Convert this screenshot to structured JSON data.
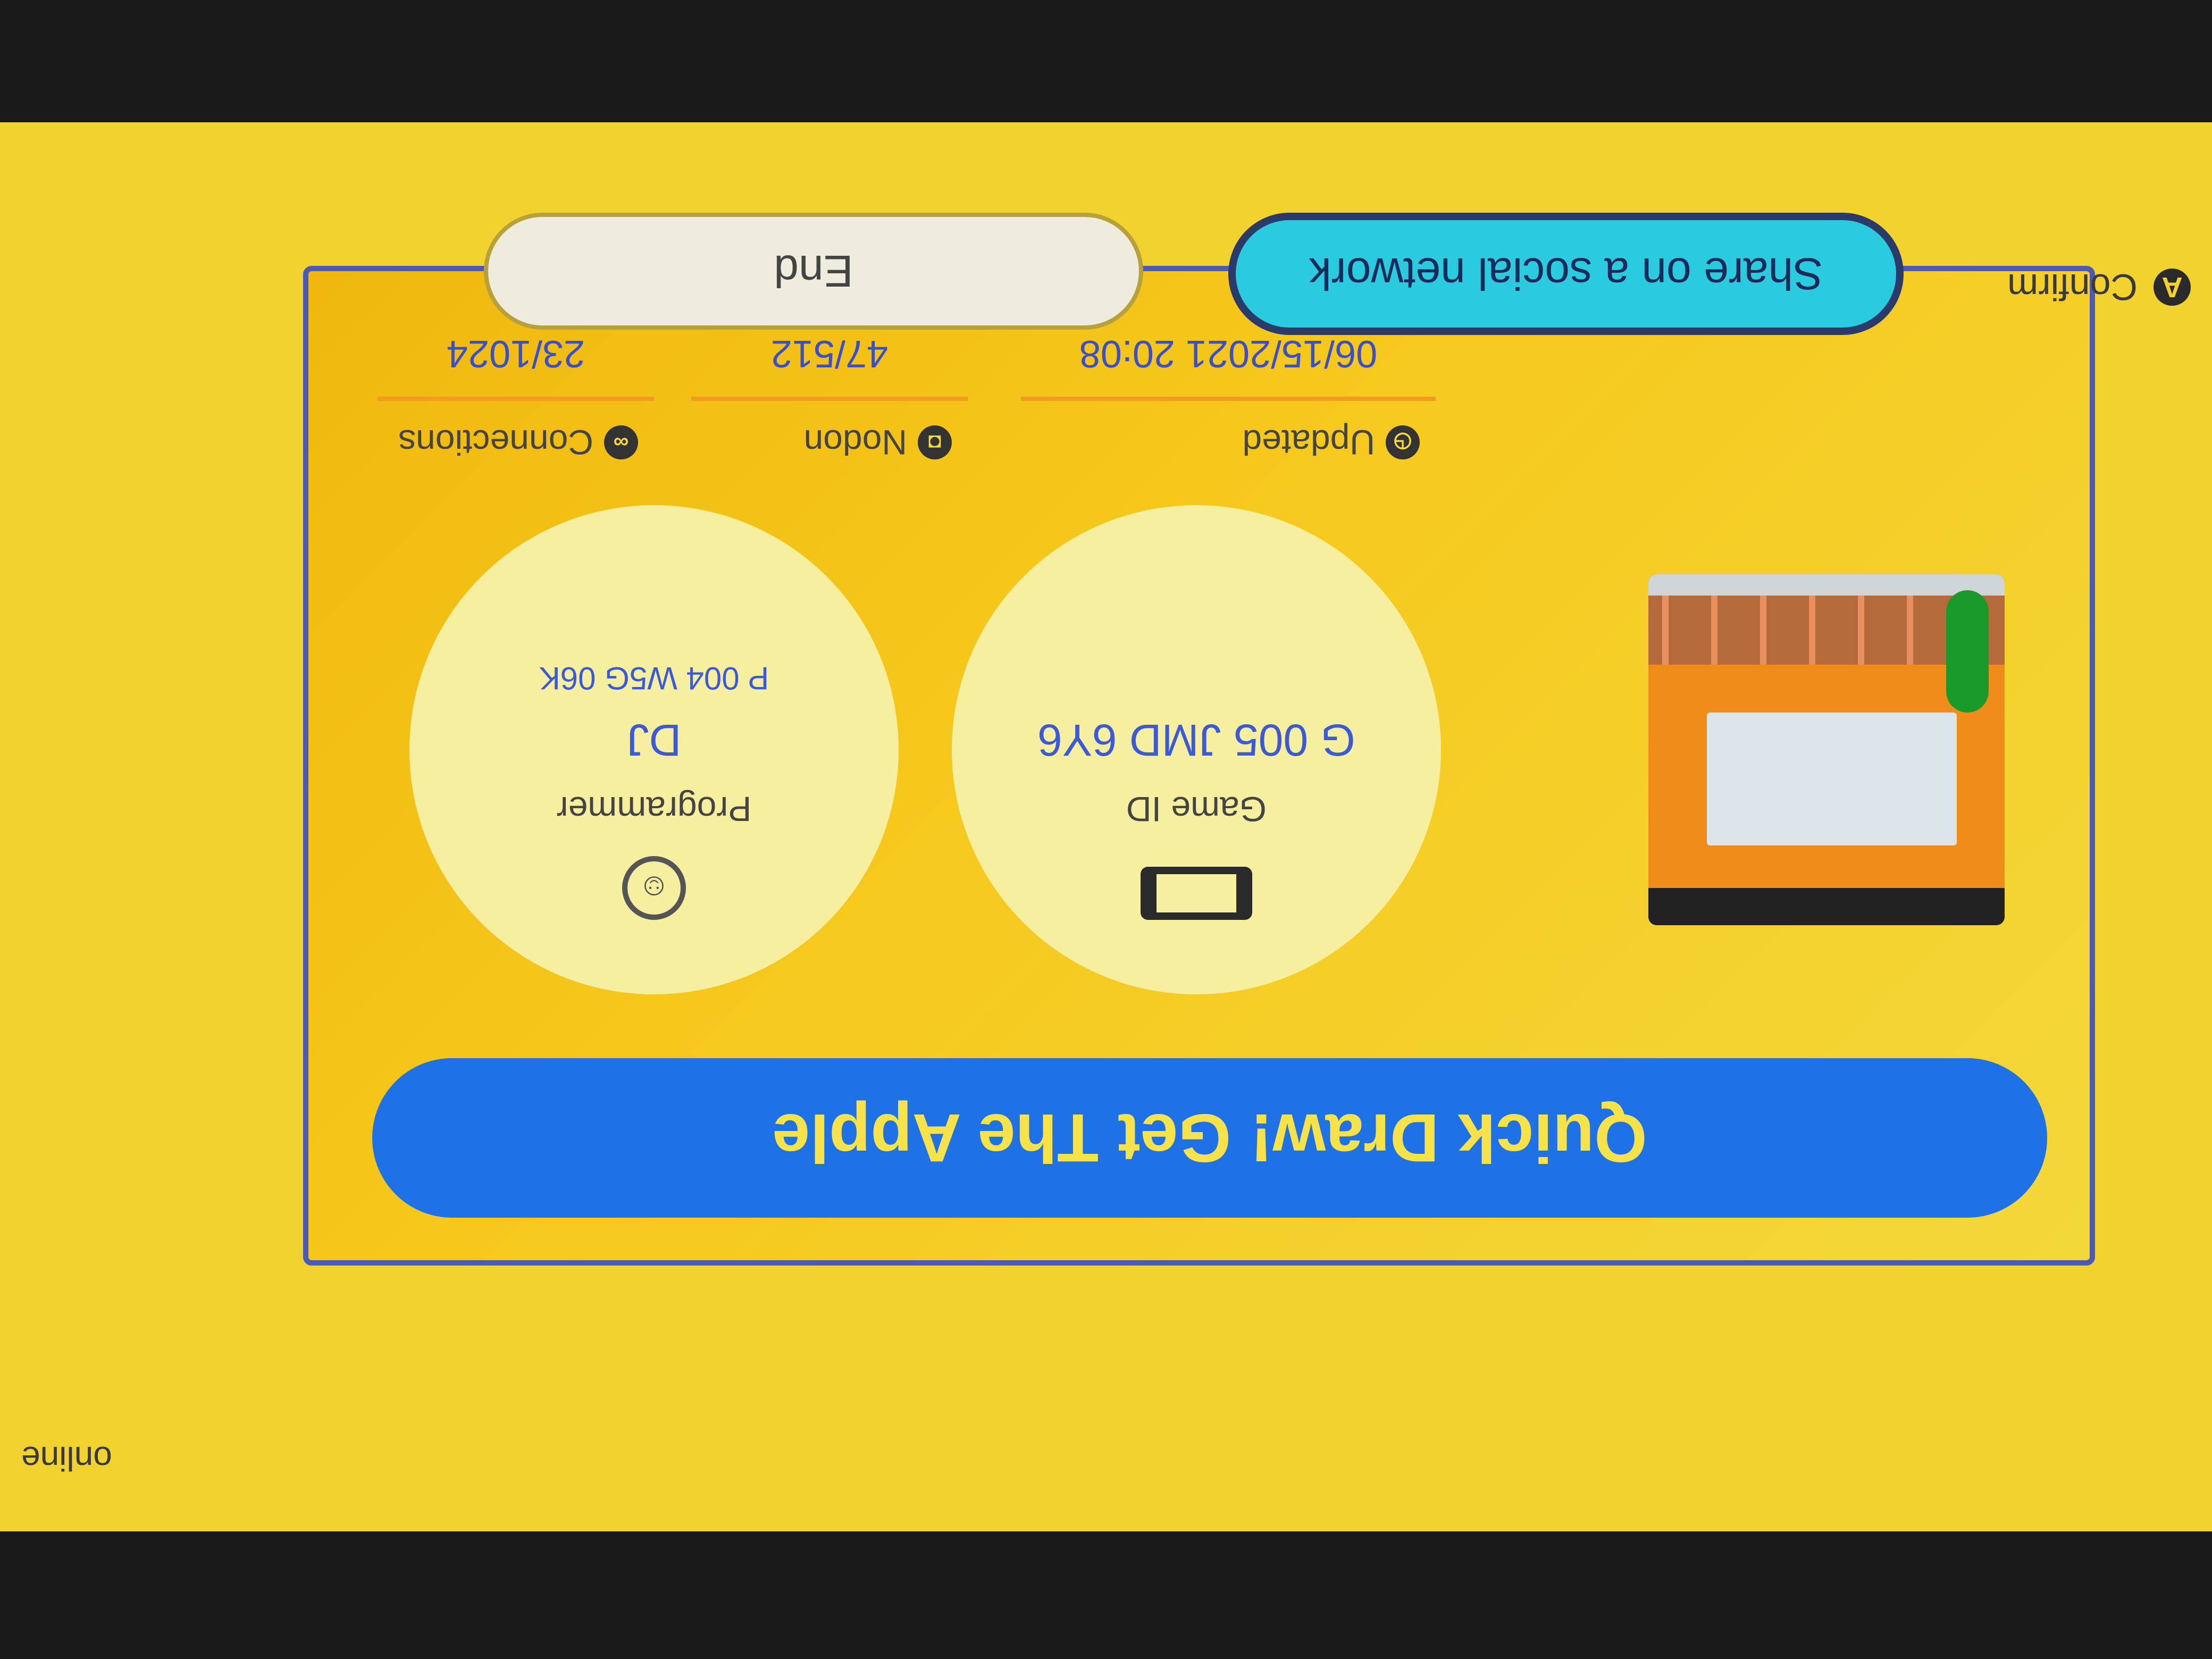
{
  "screen": {
    "status_left_label": "Confirm",
    "status_left_button": "A",
    "status_right_label": "online"
  },
  "actions": {
    "share_label": "Share on a social network",
    "end_label": "End"
  },
  "game": {
    "title": "Quick Draw! Get The Apple",
    "game_id_label": "Game ID",
    "game_id_value": "G 005 JMD 6Y6",
    "programmer_label": "Programmer",
    "programmer_name": "DJ",
    "programmer_id": "P 004 W5G 06K",
    "device_icon": "switch-console-icon",
    "programmer_icon": "face-icon"
  },
  "stats": {
    "updated_label": "Updated",
    "updated_value": "06/15/2021 20:08",
    "nodon_label": "Nodon",
    "nodon_value": "47/512",
    "connections_label": "Connections",
    "connections_value": "23/1024"
  },
  "colors": {
    "background": "#f2d22e",
    "title_bar": "#1f72e6",
    "share_button": "#2bcbdf",
    "value_text": "#3a5ad8",
    "divider": "#f29a22"
  }
}
